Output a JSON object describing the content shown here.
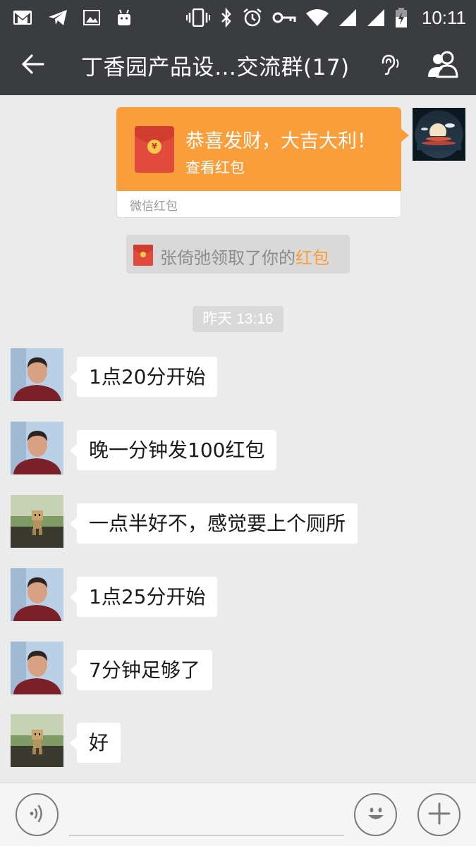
{
  "status_bar": {
    "time": "10:11",
    "icons": [
      "gmail-icon",
      "telegram-icon",
      "image-icon",
      "android-icon",
      "vibrate-icon",
      "bluetooth-icon",
      "alarm-icon",
      "key-icon",
      "wifi-icon",
      "signal-icon",
      "signal-icon",
      "battery-charging-icon"
    ]
  },
  "header": {
    "title": "丁香园产品设…交流群(17)",
    "back_icon": "back-arrow-icon",
    "ear_icon": "earpiece-icon",
    "members_icon": "group-members-icon"
  },
  "red_packet": {
    "greeting": "恭喜发财，大吉大利！",
    "action": "查看红包",
    "footer": "微信红包",
    "icon": "red-envelope-icon",
    "coin_symbol": "¥",
    "color": "#fa9d3b"
  },
  "notice": {
    "prefix": "张倚弛领取了你的",
    "link": "红包",
    "link_color": "#fa9d3b"
  },
  "timestamp": "昨天 13:16",
  "messages": [
    {
      "text": "1点20分开始",
      "sender_avatar": "avatar-man"
    },
    {
      "text": "晚一分钟发100红包",
      "sender_avatar": "avatar-man"
    },
    {
      "text": "一点半好不，感觉要上个厕所",
      "sender_avatar": "avatar-toy"
    },
    {
      "text": "1点25分开始",
      "sender_avatar": "avatar-man"
    },
    {
      "text": "7分钟足够了",
      "sender_avatar": "avatar-man"
    },
    {
      "text": "好",
      "sender_avatar": "avatar-toy"
    }
  ],
  "input_bar": {
    "voice_icon": "voice-icon",
    "input_value": "",
    "emoji_icon": "emoji-icon",
    "plus_icon": "plus-icon"
  },
  "colors": {
    "header_bg": "#3b3c40",
    "chat_bg": "#ebebeb",
    "accent": "#fa9d3b"
  }
}
